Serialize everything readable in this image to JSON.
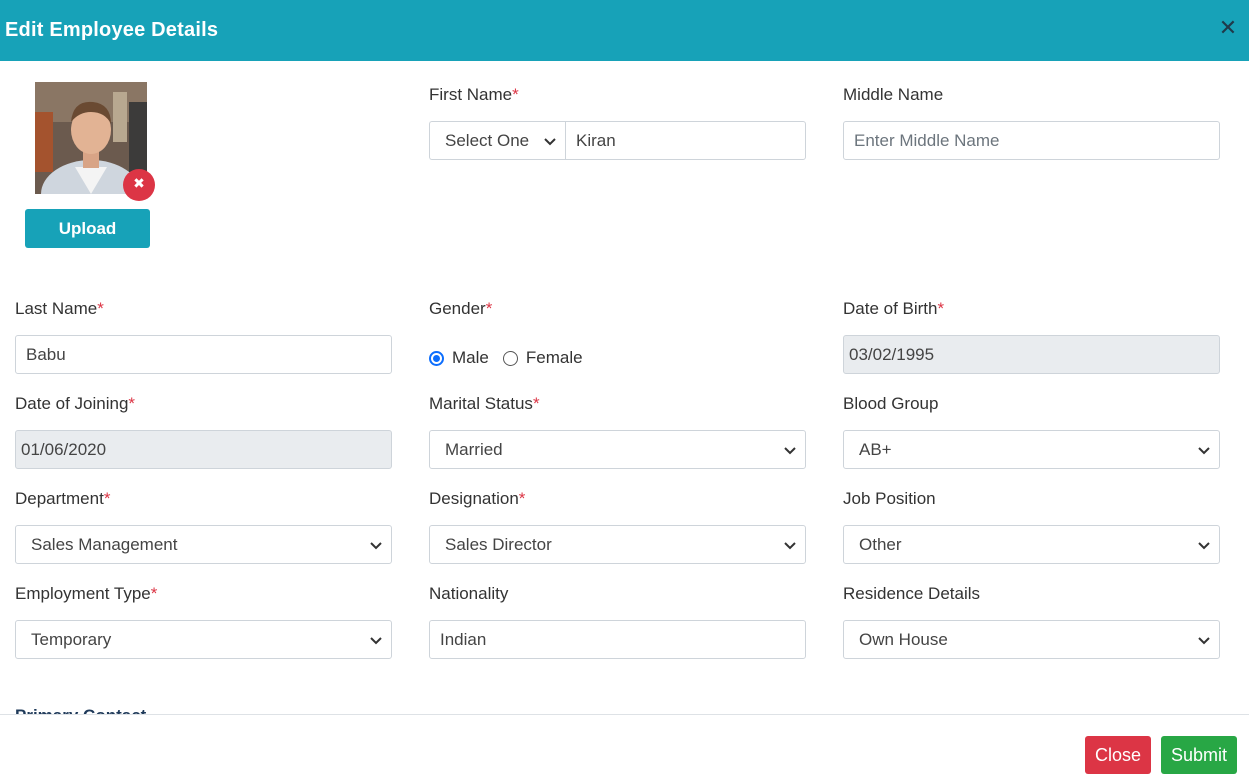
{
  "modal": {
    "title": "Edit Employee Details"
  },
  "photo": {
    "remove_glyph": "✖",
    "upload_label": "Upload"
  },
  "fields": {
    "first_name": {
      "label": "First Name",
      "prefix_value": "Select One",
      "value": "Kiran",
      "required": true
    },
    "middle_name": {
      "label": "Middle Name",
      "placeholder": "Enter Middle Name"
    },
    "last_name": {
      "label": "Last Name",
      "value": "Babu",
      "required": true
    },
    "gender": {
      "label": "Gender",
      "options": [
        "Male",
        "Female"
      ],
      "selected": "Male",
      "required": true
    },
    "dob": {
      "label": "Date of Birth",
      "value": "03/02/1995",
      "required": true
    },
    "doj": {
      "label": "Date of Joining",
      "value": "01/06/2020",
      "required": true
    },
    "marital_status": {
      "label": "Marital Status",
      "value": "Married",
      "required": true
    },
    "blood_group": {
      "label": "Blood Group",
      "value": "AB+"
    },
    "department": {
      "label": "Department",
      "value": "Sales Management",
      "required": true
    },
    "designation": {
      "label": "Designation",
      "value": "Sales Director",
      "required": true
    },
    "job_position": {
      "label": "Job Position",
      "value": "Other"
    },
    "employment_type": {
      "label": "Employment Type",
      "value": "Temporary",
      "required": true
    },
    "nationality": {
      "label": "Nationality",
      "value": "Indian"
    },
    "residence": {
      "label": "Residence Details",
      "value": "Own House"
    }
  },
  "required_mark": "*",
  "section": {
    "partial_heading": "Primary Contact"
  },
  "footer": {
    "close_label": "Close",
    "submit_label": "Submit"
  },
  "colors": {
    "header": "#17a2b8",
    "close": "#dc3545",
    "submit": "#28a745",
    "radio_checked": "#0d6efd"
  },
  "icons": [
    "close-icon",
    "chevron-down-icon",
    "remove-photo-icon"
  ]
}
